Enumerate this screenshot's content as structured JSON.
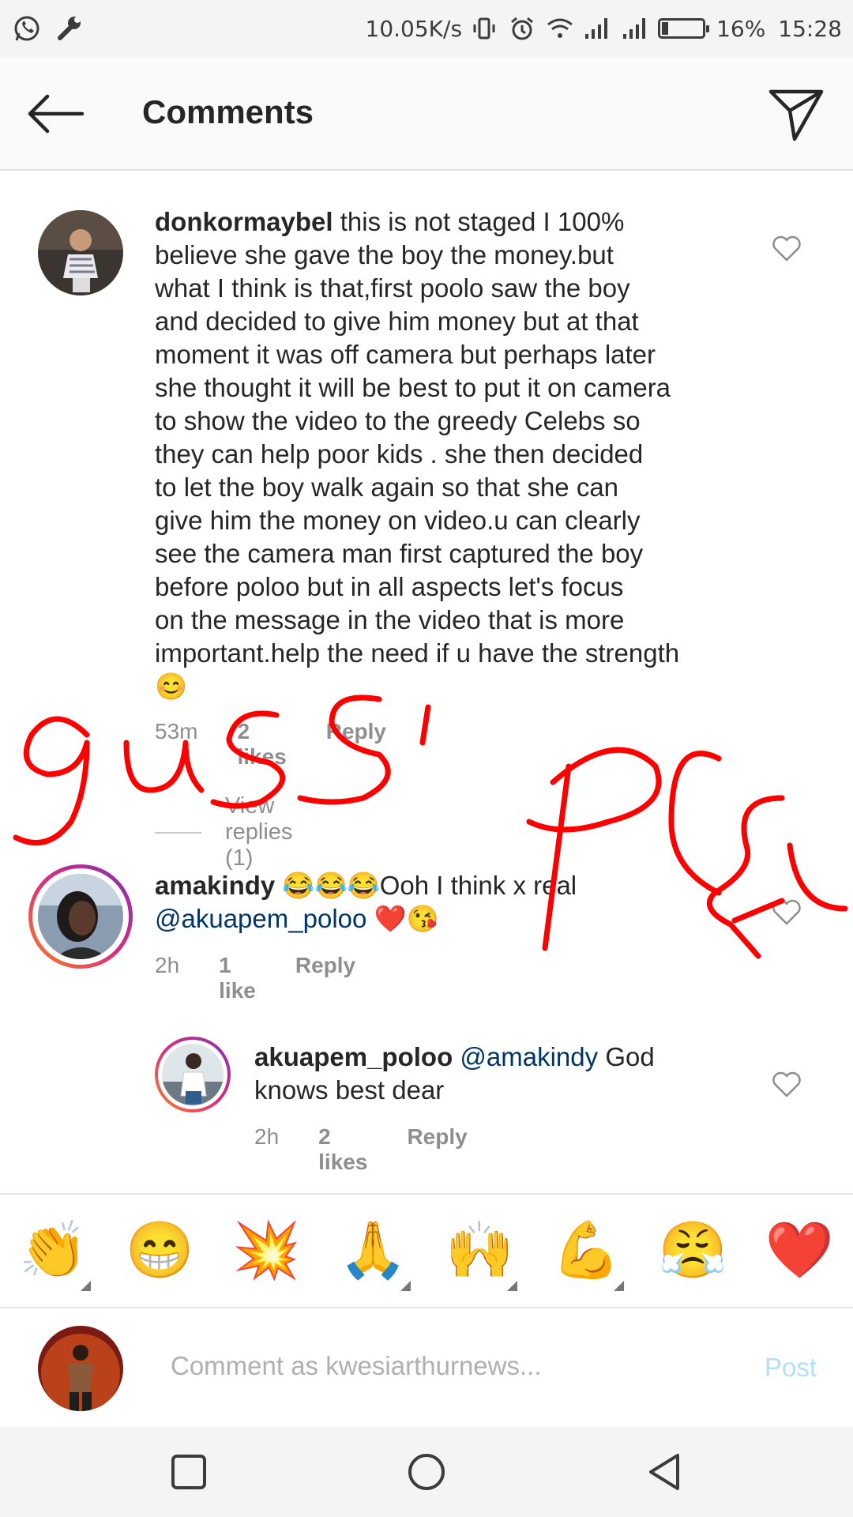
{
  "status_bar": {
    "speed": "10.05K/s",
    "battery": "16%",
    "battery_level": 0.16,
    "time": "15:28",
    "icons": [
      "whatsapp-icon",
      "wrench-icon",
      "vibrate-icon",
      "alarm-icon",
      "wifi-icon",
      "signal-icon",
      "signal-icon",
      "battery-icon"
    ]
  },
  "header": {
    "title": "Comments",
    "icons": [
      "back-arrow-icon",
      "send-icon"
    ]
  },
  "comments": [
    {
      "username": "donkormaybel",
      "text_lines": [
        "this is not staged I 100%",
        "believe she gave the boy the money.but",
        "what I think is that,first poolo saw the boy",
        "and decided to give him money but at that",
        "moment it was off camera but perhaps  later",
        "she  thought it will be best to put it on camera",
        "to show the video  to the greedy Celebs so",
        "they can help poor kids . she then  decided",
        "to let the boy walk again so that she can",
        "give him the money on video.u can clearly",
        "see the camera man  first captured the boy",
        "before poloo but in all aspects let's focus",
        "on the message in the video that is more",
        "important.help the need if u have the strength"
      ],
      "emoji": "😊",
      "time": "53m",
      "likes": "2 likes",
      "reply": "Reply",
      "view_replies": "View replies (1)"
    },
    {
      "username": "amakindy",
      "line1": "😂😂😂Ooh I think x real",
      "mention": "@akuapem_poloo",
      "line2_emoji": "❤️😘",
      "time": "2h",
      "likes": "1 like",
      "reply": "Reply"
    },
    {
      "username": "akuapem_poloo",
      "mention": "@amakindy",
      "text1": "God",
      "text2": "knows best dear",
      "time": "2h",
      "likes": "2 likes",
      "reply": "Reply"
    }
  ],
  "emoji_bar": [
    "👏",
    "😁",
    "💥",
    "🙏",
    "🙌",
    "💪",
    "😤",
    "❤️"
  ],
  "composer": {
    "placeholder": "Comment as kwesiarthurnews...",
    "post": "Post"
  },
  "navbar": {
    "icons": [
      "recents-square-icon",
      "home-circle-icon",
      "back-triangle-icon"
    ]
  },
  "colors": {
    "mention": "#003569",
    "muted": "#8e8e8e",
    "post": "#b2dffc",
    "scribble": "#ff0000",
    "ring_start": "#f58529",
    "ring_end": "#c2187a"
  }
}
